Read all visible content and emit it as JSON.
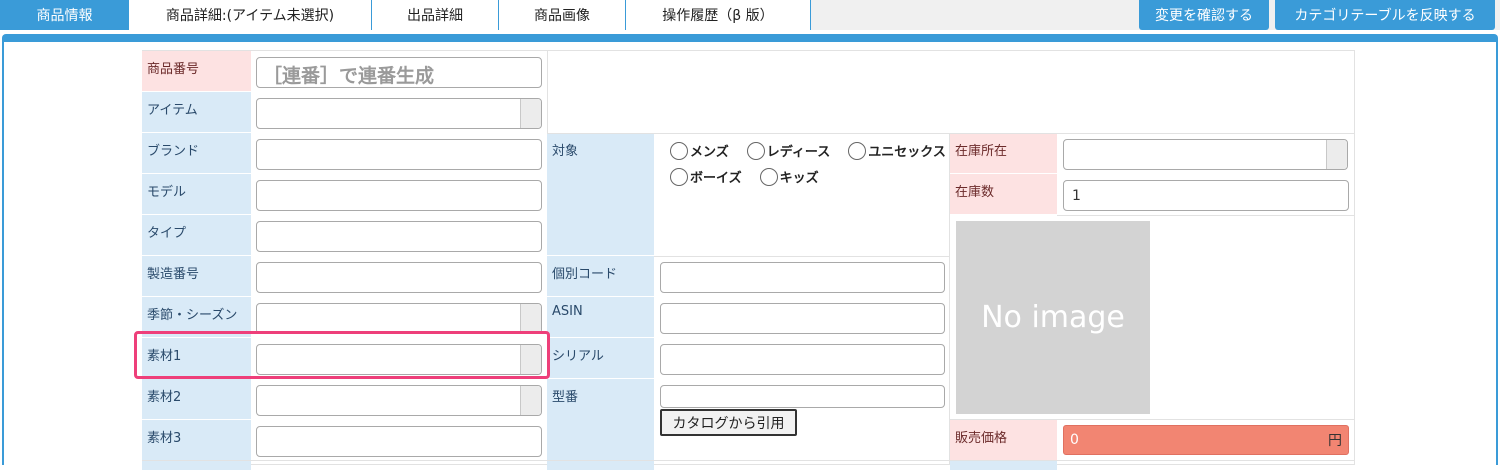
{
  "tabs": [
    {
      "label": "商品情報",
      "active": true
    },
    {
      "label": "商品詳細:(アイテム未選択)",
      "active": false
    },
    {
      "label": "出品詳細",
      "active": false
    },
    {
      "label": "商品画像",
      "active": false
    },
    {
      "label": "操作履歴（β 版）",
      "active": false
    }
  ],
  "actions": {
    "confirm_label": "変更を確認する",
    "reflect_label": "カテゴリテーブルを反映する"
  },
  "form": {
    "product_no": {
      "label": "商品番号",
      "placeholder": "［連番］で連番生成"
    },
    "item": {
      "label": "アイテム",
      "value": ""
    },
    "brand": {
      "label": "ブランド",
      "value": ""
    },
    "model": {
      "label": "モデル",
      "value": ""
    },
    "type": {
      "label": "タイプ",
      "value": ""
    },
    "serial_mfg": {
      "label": "製造番号",
      "value": ""
    },
    "season": {
      "label": "季節・シーズン",
      "value": ""
    },
    "material1": {
      "label": "素材1",
      "value": ""
    },
    "material2": {
      "label": "素材2",
      "value": ""
    },
    "material3": {
      "label": "素材3",
      "value": ""
    },
    "target": {
      "label": "対象",
      "options": [
        "メンズ",
        "レディース",
        "ユニセックス",
        "ボーイズ",
        "キッズ"
      ]
    },
    "individual_code": {
      "label": "個別コード",
      "value": ""
    },
    "asin": {
      "label": "ASIN",
      "value": ""
    },
    "serial": {
      "label": "シリアル",
      "value": ""
    },
    "model_no": {
      "label": "型番",
      "value": ""
    },
    "catalog_button": "カタログから引用",
    "stock_location": {
      "label": "在庫所在",
      "value": ""
    },
    "stock_qty": {
      "label": "在庫数",
      "value": "1"
    },
    "image_placeholder": "No image",
    "price": {
      "label": "販売価格",
      "value": "0",
      "unit": "円"
    }
  },
  "colors": {
    "accent": "#3a9bd8",
    "label_bg": "#d9eaf7",
    "label_pink": "#fde2e2",
    "price_bg": "#f28572",
    "highlight": "#ee3f7a"
  }
}
